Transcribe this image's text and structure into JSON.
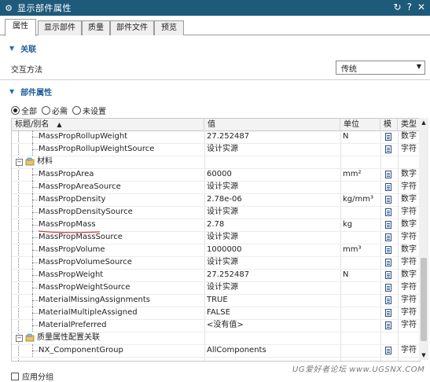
{
  "window": {
    "title": "显示部件属性",
    "tools": [
      "↻",
      "?",
      "✕"
    ]
  },
  "tabs": [
    {
      "label": "属性",
      "active": true
    },
    {
      "label": "显示部件",
      "active": false
    },
    {
      "label": "质量",
      "active": false
    },
    {
      "label": "部件文件",
      "active": false
    },
    {
      "label": "预览",
      "active": false
    }
  ],
  "association": {
    "header": "关联",
    "interaction_label": "交互方法",
    "interaction_value": "传统"
  },
  "part_properties": {
    "header": "部件属性",
    "filter_options": [
      {
        "label": "全部",
        "selected": true
      },
      {
        "label": "必需",
        "selected": false
      },
      {
        "label": "未设置",
        "selected": false
      }
    ]
  },
  "table": {
    "columns": [
      "标题/别名",
      "值",
      "单位",
      "模",
      "类型"
    ],
    "rows": [
      {
        "kind": "leaf",
        "name": "MassPropRollupWeight",
        "value": "27.252487",
        "unit": "N",
        "type": "数字"
      },
      {
        "kind": "leaf",
        "name": "MassPropRollupWeightSource",
        "value": "设计实源",
        "unit": "",
        "type": "字符"
      },
      {
        "kind": "group",
        "name": "材料"
      },
      {
        "kind": "leaf",
        "name": "MassPropArea",
        "value": "60000",
        "unit": "mm²",
        "type": "数字"
      },
      {
        "kind": "leaf",
        "name": "MassPropAreaSource",
        "value": "设计实源",
        "unit": "",
        "type": "字符"
      },
      {
        "kind": "leaf",
        "name": "MassPropDensity",
        "value": "2.78e-06",
        "unit": "kg/mm³",
        "type": "数字"
      },
      {
        "kind": "leaf",
        "name": "MassPropDensitySource",
        "value": "设计实源",
        "unit": "",
        "type": "字符"
      },
      {
        "kind": "leaf",
        "name": "MassPropMass",
        "value": "2.78",
        "unit": "kg",
        "type": "数字"
      },
      {
        "kind": "leaf",
        "name": "MassPropMassSource",
        "value": "设计实源",
        "unit": "",
        "type": "字符"
      },
      {
        "kind": "leaf",
        "name": "MassPropVolume",
        "value": "1000000",
        "unit": "mm³",
        "type": "数字"
      },
      {
        "kind": "leaf",
        "name": "MassPropVolumeSource",
        "value": "设计实源",
        "unit": "",
        "type": "字符"
      },
      {
        "kind": "leaf",
        "name": "MassPropWeight",
        "value": "27.252487",
        "unit": "N",
        "type": "数字"
      },
      {
        "kind": "leaf",
        "name": "MassPropWeightSource",
        "value": "设计实源",
        "unit": "",
        "type": "字符"
      },
      {
        "kind": "leaf",
        "name": "MaterialMissingAssignments",
        "value": "TRUE",
        "unit": "",
        "type": "字符"
      },
      {
        "kind": "leaf",
        "name": "MaterialMultipleAssigned",
        "value": "FALSE",
        "unit": "",
        "type": "字符"
      },
      {
        "kind": "leaf",
        "name": "MaterialPreferred",
        "value": "<没有值>",
        "unit": "",
        "type": "字符"
      },
      {
        "kind": "group",
        "name": "质量属性配置关联"
      },
      {
        "kind": "leaf",
        "name": "NX_ComponentGroup",
        "value": "AllComponents",
        "unit": "",
        "type": "字符"
      }
    ]
  },
  "bottom_checkbox": {
    "label": "应用分组"
  },
  "watermark": "UG爱好者论坛 www.UGSNX.COM",
  "colors": {
    "titlebar": "#1e5a7a",
    "section_header": "#1f5f9a",
    "annotation_line": "#d23a3a",
    "doc_icon": "#2b4f86"
  }
}
